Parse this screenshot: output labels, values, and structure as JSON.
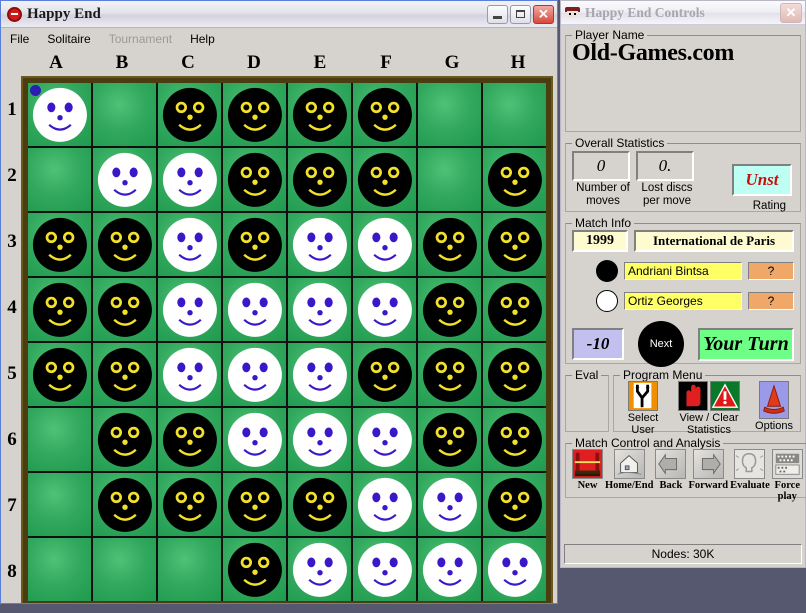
{
  "game_window": {
    "title": "Happy End",
    "icon": "stop-sign-icon",
    "buttons": {
      "minimize": "minimize-icon",
      "maximize": "maximize-icon",
      "close": "close-icon",
      "close_glyph": "✕"
    },
    "menu": [
      {
        "label": "File",
        "disabled": false
      },
      {
        "label": "Solitaire",
        "disabled": false
      },
      {
        "label": "Tournament",
        "disabled": true
      },
      {
        "label": "Help",
        "disabled": false
      }
    ]
  },
  "board": {
    "columns": [
      "A",
      "B",
      "C",
      "D",
      "E",
      "F",
      "G",
      "H"
    ],
    "rows": [
      "1",
      "2",
      "3",
      "4",
      "5",
      "6",
      "7",
      "8"
    ],
    "last_move_marker": "A1",
    "cells": [
      [
        "W",
        "",
        "B",
        "B",
        "B",
        "B",
        "",
        ""
      ],
      [
        "",
        "W",
        "W",
        "B",
        "B",
        "B",
        "",
        "B"
      ],
      [
        "B",
        "B",
        "W",
        "B",
        "W",
        "W",
        "B",
        "B"
      ],
      [
        "B",
        "B",
        "W",
        "W",
        "W",
        "W",
        "B",
        "B"
      ],
      [
        "B",
        "B",
        "W",
        "W",
        "W",
        "B",
        "B",
        "B"
      ],
      [
        "",
        "B",
        "B",
        "W",
        "W",
        "W",
        "B",
        "B"
      ],
      [
        "",
        "B",
        "B",
        "B",
        "B",
        "W",
        "W",
        "B"
      ],
      [
        "",
        "",
        "",
        "B",
        "W",
        "W",
        "W",
        "W"
      ]
    ]
  },
  "controls_window": {
    "title": "Happy End Controls",
    "icon": "player-avatar-icon",
    "close_glyph": "✕",
    "player_name_group": {
      "legend": "Player Name",
      "value": "Old-Games.com"
    },
    "overall_statistics": {
      "legend": "Overall Statistics",
      "moves": {
        "value": "0",
        "caption_line1": "Number of",
        "caption_line2": "moves"
      },
      "lost_discs": {
        "value": "0.",
        "caption_line1": "Lost discs",
        "caption_line2": "per move"
      },
      "rating": {
        "value": "Unst",
        "caption": "Rating"
      }
    },
    "match_info": {
      "legend": "Match Info",
      "year": "1999",
      "event": "International de Paris",
      "players": [
        {
          "color": "black",
          "name": "Andriani Bintsa",
          "score": "?"
        },
        {
          "color": "white",
          "name": "Ortiz Georges",
          "score": "?"
        }
      ],
      "eval_score": "-10",
      "next_button": "Next",
      "turn_status": "Your Turn"
    },
    "eval_group": {
      "legend": "Eval"
    },
    "program_menu": {
      "legend": "Program Menu",
      "items": [
        {
          "icon": "fork-road-icon",
          "line1": "Select",
          "line2": "User"
        },
        {
          "icon": "stop-hand-icon",
          "line1": "View / Clear",
          "line2": "Statistics"
        },
        {
          "icon": "warning-triangle-icon",
          "line1": "",
          "line2": ""
        },
        {
          "icon": "traffic-cones-icon",
          "line1": "Options",
          "line2": ""
        }
      ]
    },
    "match_control": {
      "legend": "Match Control and Analysis",
      "items": [
        {
          "icon": "new-game-icon",
          "label": "New"
        },
        {
          "icon": "home-end-icon",
          "label": "Home/End"
        },
        {
          "icon": "arrow-left-icon",
          "label": "Back"
        },
        {
          "icon": "arrow-right-icon",
          "label": "Forward"
        },
        {
          "icon": "lightbulb-icon",
          "label": "Evaluate"
        },
        {
          "icon": "force-play-icon",
          "label": "Force play"
        }
      ]
    },
    "status_bar": "Nodes: 30K"
  }
}
